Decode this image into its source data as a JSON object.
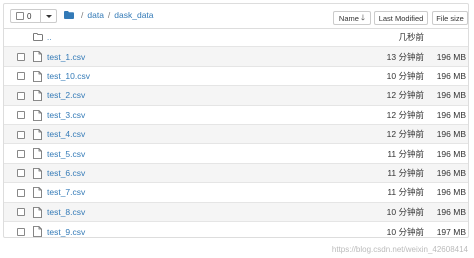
{
  "toolbar": {
    "selected_count": "0",
    "breadcrumb": [
      "data",
      "dask_data"
    ],
    "sort_name_label": "Name",
    "sort_modified_label": "Last Modified",
    "sort_size_label": "File size"
  },
  "parent_row": {
    "name": "..",
    "modified": "几秒前"
  },
  "files": [
    {
      "name": "test_1.csv",
      "modified": "13 分钟前",
      "size": "196 MB"
    },
    {
      "name": "test_10.csv",
      "modified": "10 分钟前",
      "size": "196 MB"
    },
    {
      "name": "test_2.csv",
      "modified": "12 分钟前",
      "size": "196 MB"
    },
    {
      "name": "test_3.csv",
      "modified": "12 分钟前",
      "size": "196 MB"
    },
    {
      "name": "test_4.csv",
      "modified": "12 分钟前",
      "size": "196 MB"
    },
    {
      "name": "test_5.csv",
      "modified": "11 分钟前",
      "size": "196 MB"
    },
    {
      "name": "test_6.csv",
      "modified": "11 分钟前",
      "size": "196 MB"
    },
    {
      "name": "test_7.csv",
      "modified": "11 分钟前",
      "size": "196 MB"
    },
    {
      "name": "test_8.csv",
      "modified": "10 分钟前",
      "size": "196 MB"
    },
    {
      "name": "test_9.csv",
      "modified": "10 分钟前",
      "size": "197 MB"
    }
  ],
  "watermark": "https://blog.csdn.net/weixin_42608414",
  "colors": {
    "link": "#337ab7",
    "border": "#dddddd",
    "row_alt": "#f5f5f5"
  }
}
